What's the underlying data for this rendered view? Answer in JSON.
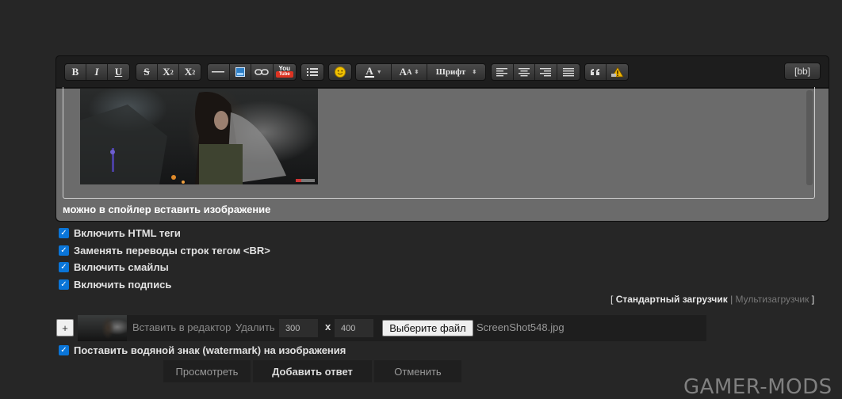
{
  "toolbar": {
    "bold": "B",
    "italic": "I",
    "underline": "U",
    "strike": "S",
    "sup": "X",
    "sup_mark": "2",
    "sub": "X",
    "sub_mark": "2",
    "youtube_top": "You",
    "youtube_bottom": "Tube",
    "color_letter": "A",
    "size_big": "A",
    "size_small": "A",
    "font_label": "Шрифт",
    "bb_label": "[bb]"
  },
  "editor": {
    "caption": "можно в спойлер вставить изображение"
  },
  "options": [
    {
      "label": "Включить HTML теги",
      "checked": true
    },
    {
      "label": "Заменять переводы строк тегом <BR>",
      "checked": true
    },
    {
      "label": "Включить смайлы",
      "checked": true
    },
    {
      "label": "Включить подпись",
      "checked": true
    }
  ],
  "uploaders": {
    "open": "[",
    "standard": "Стандартный загрузчик",
    "sep": "|",
    "multi": "Мультизагрузчик",
    "close": "]"
  },
  "upload": {
    "add_label": "+",
    "insert_label": "Вставить в редактор",
    "delete_label": "Удалить",
    "width": "300",
    "x_label": "x",
    "height": "400",
    "file_button": "Выберите файл",
    "filename": "ScreenShot548.jpg"
  },
  "watermark_option": {
    "label": "Поставить водяной знак (watermark) на изображения",
    "checked": true
  },
  "actions": {
    "preview": "Просмотреть",
    "submit": "Добавить ответ",
    "cancel": "Отменить"
  },
  "site_watermark": "GAMER-MODS",
  "colors": {
    "page_bg": "#262626",
    "checkbox": "#0a75d8",
    "content_bg": "#6b6b6b"
  }
}
